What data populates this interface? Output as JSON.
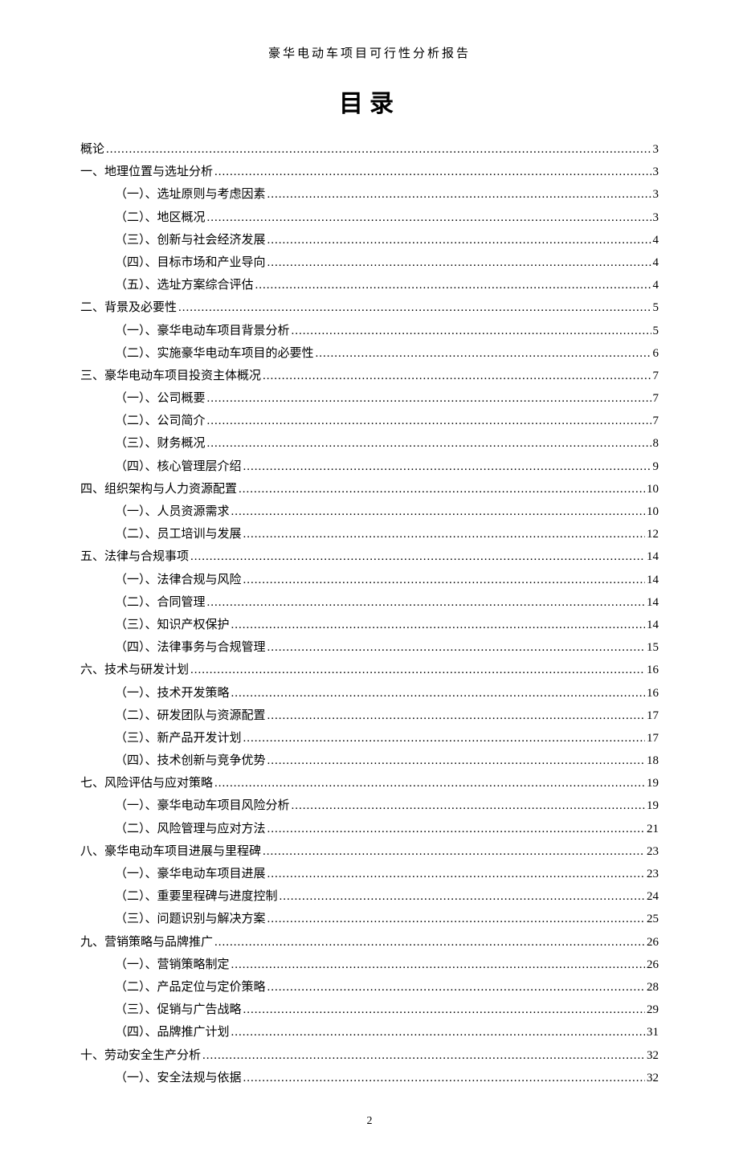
{
  "header": "豪华电动车项目可行性分析报告",
  "title": "目录",
  "page_footer": "2",
  "toc": [
    {
      "label": "概论",
      "page": "3",
      "indent": 0
    },
    {
      "label": "一、地理位置与选址分析",
      "page": "3",
      "indent": 0
    },
    {
      "label": "（一）、选址原则与考虑因素",
      "page": "3",
      "indent": 1
    },
    {
      "label": "（二）、地区概况",
      "page": "3",
      "indent": 1
    },
    {
      "label": "（三）、创新与社会经济发展",
      "page": "4",
      "indent": 1
    },
    {
      "label": "（四）、目标市场和产业导向",
      "page": "4",
      "indent": 1
    },
    {
      "label": "（五）、选址方案综合评估",
      "page": "4",
      "indent": 1
    },
    {
      "label": "二、背景及必要性 ",
      "page": "5",
      "indent": 0
    },
    {
      "label": "（一）、豪华电动车项目背景分析",
      "page": "5",
      "indent": 1
    },
    {
      "label": "（二）、实施豪华电动车项目的必要性",
      "page": "6",
      "indent": 1
    },
    {
      "label": "三、豪华电动车项目投资主体概况",
      "page": "7",
      "indent": 0
    },
    {
      "label": "（一）、公司概要",
      "page": "7",
      "indent": 1
    },
    {
      "label": "（二）、公司简介",
      "page": "7",
      "indent": 1
    },
    {
      "label": "（三）、财务概况",
      "page": "8",
      "indent": 1
    },
    {
      "label": "（四）、核心管理层介绍",
      "page": "9",
      "indent": 1
    },
    {
      "label": "四、组织架构与人力资源配置",
      "page": "10",
      "indent": 0
    },
    {
      "label": "（一）、人员资源需求",
      "page": "10",
      "indent": 1
    },
    {
      "label": "（二）、员工培训与发展",
      "page": "12",
      "indent": 1
    },
    {
      "label": "五、法律与合规事项 ",
      "page": "14",
      "indent": 0
    },
    {
      "label": "（一）、法律合规与风险",
      "page": "14",
      "indent": 1
    },
    {
      "label": "（二）、合同管理 ",
      "page": "14",
      "indent": 1
    },
    {
      "label": "（三）、知识产权保护",
      "page": "14",
      "indent": 1
    },
    {
      "label": "（四）、法律事务与合规管理",
      "page": "15",
      "indent": 1
    },
    {
      "label": "六、技术与研发计划 ",
      "page": "16",
      "indent": 0
    },
    {
      "label": "（一）、技术开发策略",
      "page": "16",
      "indent": 1
    },
    {
      "label": "（二）、研发团队与资源配置",
      "page": "17",
      "indent": 1
    },
    {
      "label": "（三）、新产品开发计划",
      "page": "17",
      "indent": 1
    },
    {
      "label": "（四）、技术创新与竞争优势",
      "page": "18",
      "indent": 1
    },
    {
      "label": "七、风险评估与应对策略",
      "page": "19",
      "indent": 0
    },
    {
      "label": "（一）、豪华电动车项目风险分析",
      "page": "19",
      "indent": 1
    },
    {
      "label": "（二）、风险管理与应对方法",
      "page": "21",
      "indent": 1
    },
    {
      "label": "八、豪华电动车项目进展与里程碑",
      "page": "23",
      "indent": 0
    },
    {
      "label": "（一）、豪华电动车项目进展",
      "page": "23",
      "indent": 1
    },
    {
      "label": "（二）、重要里程碑与进度控制",
      "page": "24",
      "indent": 1
    },
    {
      "label": "（三）、问题识别与解决方案",
      "page": "25",
      "indent": 1
    },
    {
      "label": "九、营销策略与品牌推广",
      "page": "26",
      "indent": 0
    },
    {
      "label": "（一）、营销策略制定",
      "page": "26",
      "indent": 1
    },
    {
      "label": "（二）、产品定位与定价策略",
      "page": "28",
      "indent": 1
    },
    {
      "label": "（三）、促销与广告战略",
      "page": "29",
      "indent": 1
    },
    {
      "label": "（四）、品牌推广计划",
      "page": "31",
      "indent": 1
    },
    {
      "label": "十、劳动安全生产分析",
      "page": "32",
      "indent": 0
    },
    {
      "label": "（一）、安全法规与依据",
      "page": "32",
      "indent": 1
    }
  ]
}
